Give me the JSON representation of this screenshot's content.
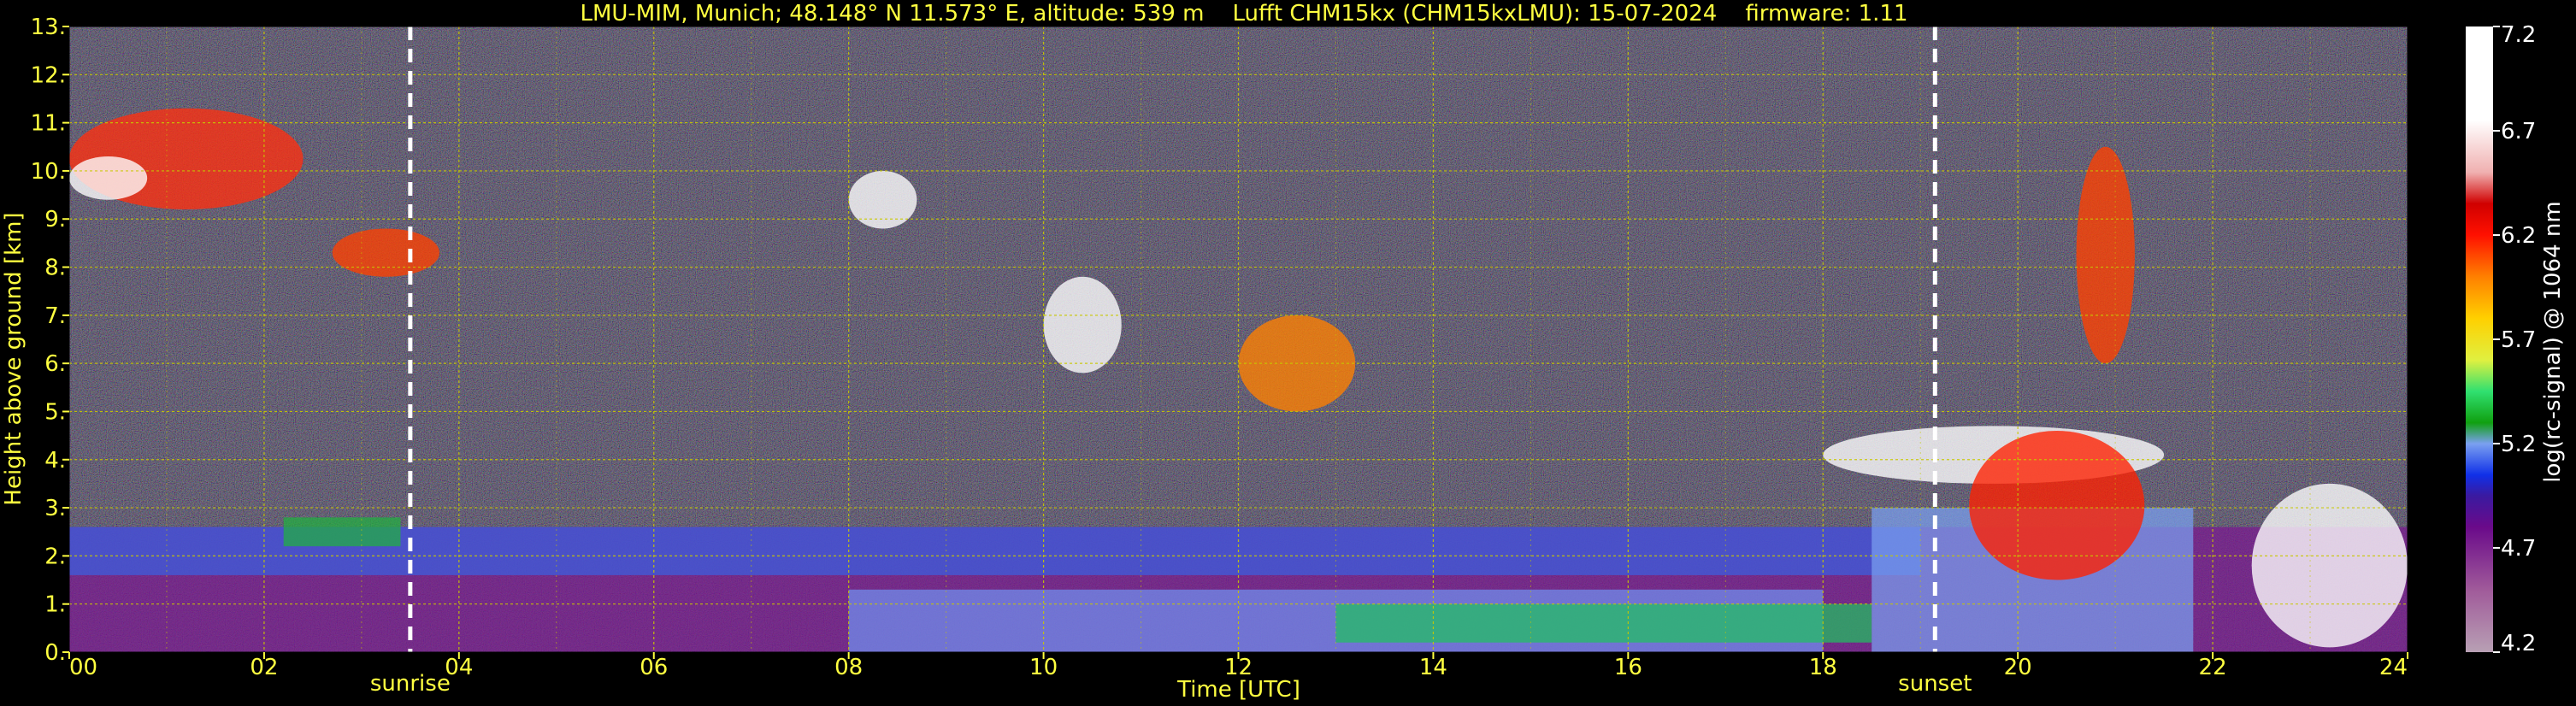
{
  "chart_data": {
    "type": "heatmap",
    "title": "LMU-MIM, Munich; 48.148° N 11.573° E, altitude: 539 m    Lufft CHM15kx (CHM15kxLMU): 15-07-2024    firmware: 1.11",
    "xlabel": "Time [UTC]",
    "ylabel": "Height above ground [km]",
    "xlim": [
      0,
      24
    ],
    "ylim": [
      0,
      13
    ],
    "x_ticks": [
      "00",
      "02",
      "04",
      "06",
      "08",
      "10",
      "12",
      "14",
      "16",
      "18",
      "20",
      "22",
      "24"
    ],
    "x_tick_values": [
      0,
      2,
      4,
      6,
      8,
      10,
      12,
      14,
      16,
      18,
      20,
      22,
      24
    ],
    "y_ticks": [
      "0.",
      "1.",
      "2.",
      "3.",
      "4.",
      "5.",
      "6.",
      "7.",
      "8.",
      "9.",
      "10.",
      "11.",
      "12.",
      "13."
    ],
    "y_tick_values": [
      0,
      1,
      2,
      3,
      4,
      5,
      6,
      7,
      8,
      9,
      10,
      11,
      12,
      13
    ],
    "grid": true,
    "vlines": [
      {
        "x": 3.5,
        "label": "sunrise"
      },
      {
        "x": 19.15,
        "label": "sunset"
      }
    ],
    "colorbar": {
      "label": "log(rc-signal) @ 1064 nm",
      "range": [
        4.2,
        7.2
      ],
      "ticks": [
        "4.2",
        "4.7",
        "5.2",
        "5.7",
        "6.2",
        "6.7",
        "7.2"
      ],
      "tick_values": [
        4.2,
        4.7,
        5.2,
        5.7,
        6.2,
        6.7,
        7.2
      ],
      "stops": [
        {
          "v": 4.2,
          "color": "#b8a0b4"
        },
        {
          "v": 4.5,
          "color": "#a05a9a"
        },
        {
          "v": 4.8,
          "color": "#6a0a8a"
        },
        {
          "v": 4.95,
          "color": "#3a1aa0"
        },
        {
          "v": 5.05,
          "color": "#1030e8"
        },
        {
          "v": 5.2,
          "color": "#7aa0f0"
        },
        {
          "v": 5.3,
          "color": "#10a010"
        },
        {
          "v": 5.45,
          "color": "#30e070"
        },
        {
          "v": 5.6,
          "color": "#e0f040"
        },
        {
          "v": 5.8,
          "color": "#ffd000"
        },
        {
          "v": 6.0,
          "color": "#ff8000"
        },
        {
          "v": 6.2,
          "color": "#ff1000"
        },
        {
          "v": 6.35,
          "color": "#d00000"
        },
        {
          "v": 6.5,
          "color": "#f0b0b0"
        },
        {
          "v": 6.75,
          "color": "#ffffff"
        }
      ]
    },
    "layers": [
      {
        "name": "boundary-layer-purple",
        "t0": 0,
        "t1": 24,
        "h0": 0,
        "h1": 2.6,
        "value": 4.75,
        "color": "#7a1890"
      },
      {
        "name": "residual-layer-blue",
        "t0": 0,
        "t1": 19.0,
        "h0": 1.6,
        "h1": 2.6,
        "value": 5.15,
        "color": "#3a60e0"
      },
      {
        "name": "aerosol-band-green-morning",
        "t0": 2.2,
        "t1": 3.4,
        "h0": 2.2,
        "h1": 2.8,
        "value": 5.35,
        "color": "#20b040"
      },
      {
        "name": "mixed-layer-blue",
        "t0": 8.0,
        "t1": 18.0,
        "h0": 0,
        "h1": 1.3,
        "value": 5.2,
        "color": "#7090f0"
      },
      {
        "name": "mixed-layer-green",
        "t0": 13.0,
        "t1": 18.5,
        "h0": 0.2,
        "h1": 1.0,
        "value": 5.35,
        "color": "#20c060"
      },
      {
        "name": "evening-layer-blue",
        "t0": 18.5,
        "t1": 21.8,
        "h0": 0,
        "h1": 3.0,
        "value": 5.2,
        "color": "#7aa0f0"
      }
    ],
    "cloud_features": [
      {
        "name": "cirrus-morning",
        "t0": 0,
        "t1": 2.4,
        "h0": 9.2,
        "h1": 11.3,
        "value": 6.3,
        "color": "#ff3010"
      },
      {
        "name": "cirrus-morning-core",
        "t0": 0,
        "t1": 0.8,
        "h0": 9.4,
        "h1": 10.3,
        "value": 6.8,
        "color": "#ffffff"
      },
      {
        "name": "cirrus-dawn",
        "t0": 2.7,
        "t1": 3.8,
        "h0": 7.8,
        "h1": 8.8,
        "value": 6.2,
        "color": "#ff4000"
      },
      {
        "name": "cirrus-0830",
        "t0": 8.0,
        "t1": 8.7,
        "h0": 8.8,
        "h1": 10.0,
        "value": 6.8,
        "color": "#ffffff"
      },
      {
        "name": "cloud-1030",
        "t0": 10.0,
        "t1": 10.8,
        "h0": 5.8,
        "h1": 7.8,
        "value": 6.8,
        "color": "#ffffff"
      },
      {
        "name": "cloud-1230",
        "t0": 12.0,
        "t1": 13.2,
        "h0": 5.0,
        "h1": 7.0,
        "value": 6.3,
        "color": "#ff8000"
      },
      {
        "name": "alto-layer-evening",
        "t0": 18.0,
        "t1": 21.5,
        "h0": 3.5,
        "h1": 4.7,
        "value": 6.8,
        "color": "#ffffff"
      },
      {
        "name": "convective-2030",
        "t0": 19.5,
        "t1": 21.3,
        "h0": 1.5,
        "h1": 4.6,
        "value": 6.2,
        "color": "#ff2000"
      },
      {
        "name": "cirrus-2100",
        "t0": 20.6,
        "t1": 21.2,
        "h0": 6.0,
        "h1": 10.5,
        "value": 6.2,
        "color": "#ff4000"
      },
      {
        "name": "low-cloud-night",
        "t0": 22.4,
        "t1": 24,
        "h0": 0.1,
        "h1": 3.5,
        "value": 6.6,
        "color": "#ffffff"
      }
    ]
  }
}
